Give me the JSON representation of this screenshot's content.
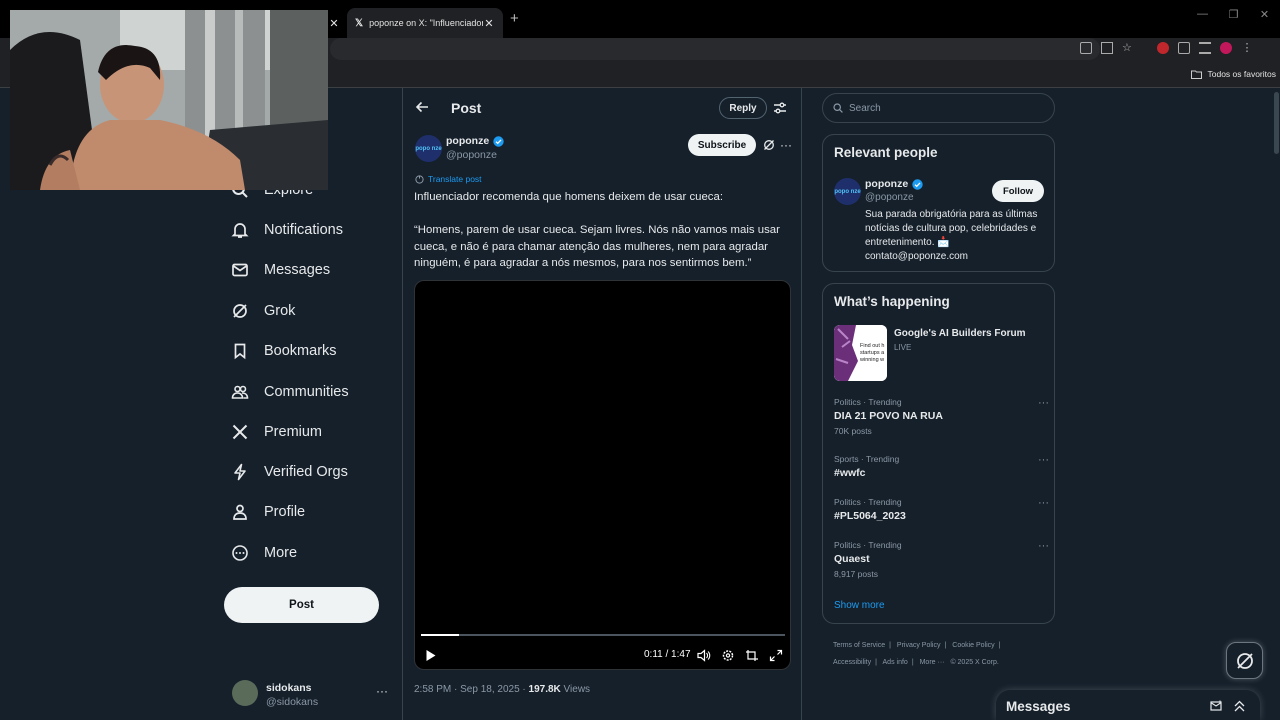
{
  "browser": {
    "active_tab_title": "poponze on X: \"Influenciador r",
    "bookmarks_folder": "Todos os favoritos"
  },
  "nav": {
    "items": [
      {
        "label": "Explore",
        "icon": "search-icon"
      },
      {
        "label": "Notifications",
        "icon": "bell-icon"
      },
      {
        "label": "Messages",
        "icon": "envelope-icon"
      },
      {
        "label": "Grok",
        "icon": "grok-icon"
      },
      {
        "label": "Bookmarks",
        "icon": "bookmark-icon"
      },
      {
        "label": "Communities",
        "icon": "people-icon"
      },
      {
        "label": "Premium",
        "icon": "x-logo-icon"
      },
      {
        "label": "Verified Orgs",
        "icon": "lightning-icon"
      },
      {
        "label": "Profile",
        "icon": "person-icon"
      },
      {
        "label": "More",
        "icon": "more-circle-icon"
      }
    ],
    "post_button": "Post",
    "account": {
      "name": "sidokans",
      "handle": "@sidokans"
    }
  },
  "main": {
    "header_title": "Post",
    "reply_label": "Reply",
    "author": {
      "name": "poponze",
      "handle": "@poponze",
      "avatar_text": "popo nze"
    },
    "subscribe_label": "Subscribe",
    "translate_label": "Translate post",
    "text_line1": "Influenciador recomenda que homens deixem de usar cueca:",
    "text_quote": "“Homens, parem de usar cueca. Sejam livres. Nós não vamos mais usar cueca, e não é para chamar atenção das mulheres, nem para agradar ninguém, é para agradar a nós mesmos, para nos sentirmos bem.”",
    "video": {
      "time": "0:11 / 1:47",
      "progress": 0.105
    },
    "meta_time": "2:58 PM · Sep 18, 2025 · ",
    "meta_views_count": "197.8K",
    "meta_views_label": " Views"
  },
  "right": {
    "search_placeholder": "Search",
    "relevant_title": "Relevant people",
    "person": {
      "name": "poponze",
      "handle": "@poponze",
      "follow_label": "Follow",
      "bio": "Sua parada obrigatória para as últimas notícias de cultura pop, celebridades e entretenimento. 📩 contato@poponze.com"
    },
    "happening_title": "What’s happening",
    "event": {
      "title": "Google's AI Builders Forum",
      "status": "LIVE",
      "image_text": "Find out h startups a winning w"
    },
    "trends": [
      {
        "category": "Politics · Trending",
        "name": "DIA 21 POVO NA RUA",
        "count": "70K posts"
      },
      {
        "category": "Sports · Trending",
        "name": "#wwfc",
        "count": ""
      },
      {
        "category": "Politics · Trending",
        "name": "#PL5064_2023",
        "count": ""
      },
      {
        "category": "Politics · Trending",
        "name": "Quaest",
        "count": "8,917 posts"
      }
    ],
    "show_more": "Show more",
    "footer": {
      "terms": "Terms of Service",
      "privacy": "Privacy Policy",
      "cookie": "Cookie Policy",
      "accessibility": "Accessibility",
      "ads": "Ads info",
      "more": "More ···",
      "copyright": "© 2025 X Corp."
    }
  },
  "messages_drawer": {
    "title": "Messages"
  },
  "colors": {
    "background": "#15202b",
    "accent": "#1d9bf0",
    "border": "#38444d"
  }
}
